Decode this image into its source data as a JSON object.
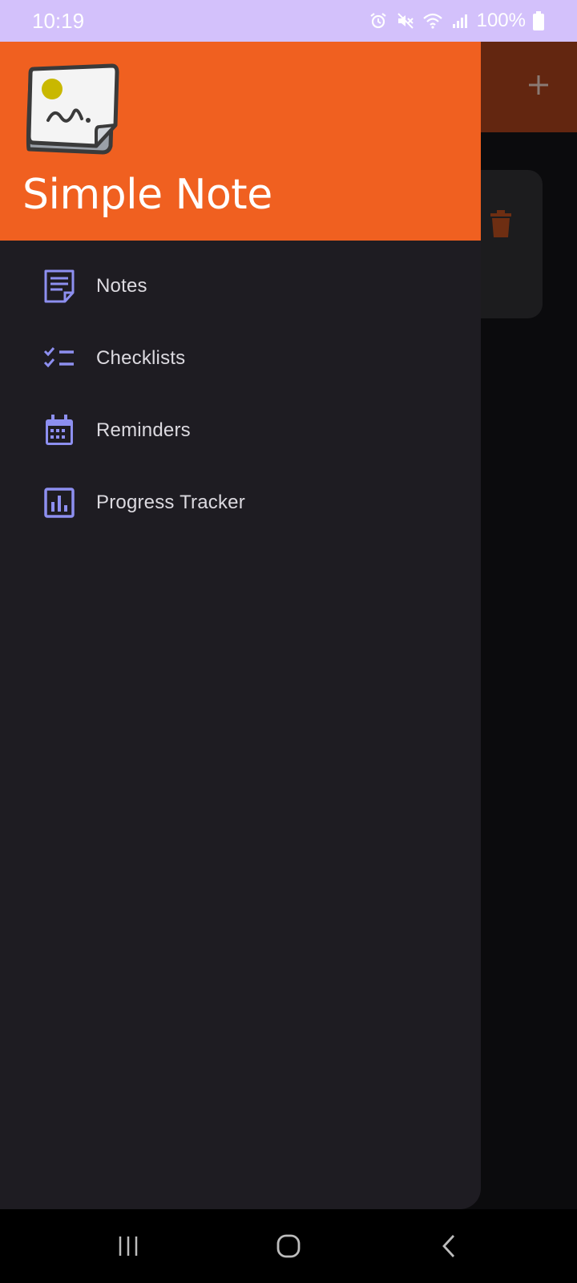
{
  "status_bar": {
    "time": "10:19",
    "battery_text": "100%",
    "icons": [
      "alarm-icon",
      "mute-icon",
      "wifi-icon",
      "signal-icon",
      "battery-icon"
    ]
  },
  "drawer": {
    "app_title": "Simple Note",
    "items": [
      {
        "label": "Notes",
        "icon": "note-icon"
      },
      {
        "label": "Checklists",
        "icon": "checklist-icon"
      },
      {
        "label": "Reminders",
        "icon": "calendar-icon"
      },
      {
        "label": "Progress Tracker",
        "icon": "chart-icon"
      }
    ]
  },
  "colors": {
    "header": "#f06020",
    "drawer_bg": "#1e1c22",
    "icon_accent": "#8d8ff0",
    "status_bar": "#d3c1fb"
  },
  "background_screen": {
    "add_icon": "plus-icon",
    "card_icon": "trash-icon"
  },
  "system_nav": [
    "recents-button",
    "home-button",
    "back-button"
  ]
}
